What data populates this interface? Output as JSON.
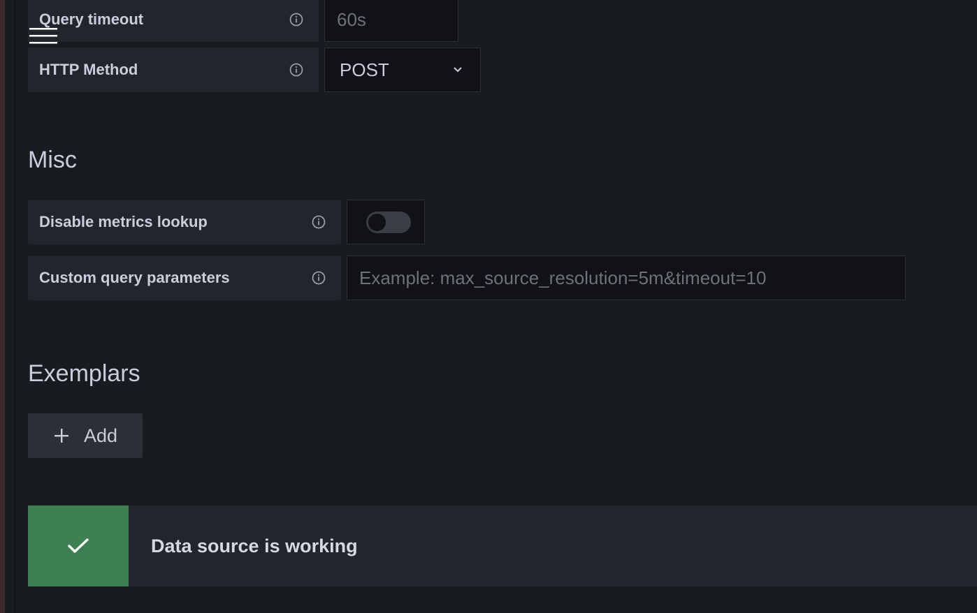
{
  "fields": {
    "query_timeout": {
      "label": "Query timeout",
      "placeholder": "60s"
    },
    "http_method": {
      "label": "HTTP Method",
      "value": "POST"
    },
    "disable_metrics_lookup": {
      "label": "Disable metrics lookup",
      "enabled": false
    },
    "custom_query_parameters": {
      "label": "Custom query parameters",
      "placeholder": "Example: max_source_resolution=5m&timeout=10"
    }
  },
  "sections": {
    "misc": "Misc",
    "exemplars": "Exemplars"
  },
  "exemplars": {
    "add_label": "Add"
  },
  "status": {
    "message": "Data source is working",
    "color": "#3d8051"
  },
  "icons": {
    "menu": "hamburger-menu-icon",
    "info": "info-circle-icon",
    "dropdown": "chevron-down-icon",
    "add": "plus-icon",
    "success": "check-icon"
  }
}
